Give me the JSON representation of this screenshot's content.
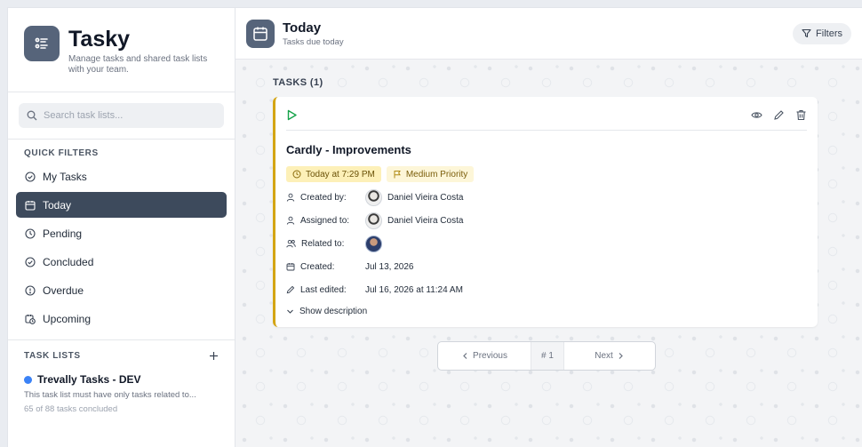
{
  "brand": {
    "name": "Tasky",
    "tagline": "Manage tasks and shared task lists with your team."
  },
  "search": {
    "placeholder": "Search task lists..."
  },
  "quick_filters": {
    "title": "QUICK FILTERS",
    "items": [
      {
        "label": "My Tasks",
        "icon": "check-circle-icon"
      },
      {
        "label": "Today",
        "icon": "calendar-icon",
        "active": true
      },
      {
        "label": "Pending",
        "icon": "clock-icon"
      },
      {
        "label": "Concluded",
        "icon": "check-circle-icon"
      },
      {
        "label": "Overdue",
        "icon": "alert-circle-icon"
      },
      {
        "label": "Upcoming",
        "icon": "calendar-clock-icon"
      }
    ]
  },
  "task_lists": {
    "title": "TASK LISTS",
    "add_icon": "plus-icon",
    "items": [
      {
        "name": "Trevally Tasks - DEV",
        "description": "This task list must have only tasks related to...",
        "count": "65 of 88 tasks concluded",
        "color": "#3b82f6"
      }
    ]
  },
  "header": {
    "title": "Today",
    "subtitle": "Tasks due today",
    "filters_label": "Filters"
  },
  "tasks": {
    "label": "TASKS (1)",
    "card": {
      "title": "Cardly - Improvements",
      "due_badge": "Today at 7:29 PM",
      "priority_badge": "Medium Priority",
      "created_by_label": "Created by:",
      "created_by": "Daniel Vieira Costa",
      "assigned_to_label": "Assigned to:",
      "assigned_to": "Daniel Vieira Costa",
      "related_to_label": "Related to:",
      "created_label": "Created:",
      "created": "Jul 13, 2026",
      "last_edited_label": "Last edited:",
      "last_edited": "Jul 16, 2026 at 11:24 AM",
      "show_description": "Show description"
    }
  },
  "pagination": {
    "previous": "Previous",
    "page": "# 1",
    "next": "Next"
  },
  "colors": {
    "accent": "#3d4a5c",
    "card_border": "#d4a514",
    "play": "#16a34a"
  }
}
